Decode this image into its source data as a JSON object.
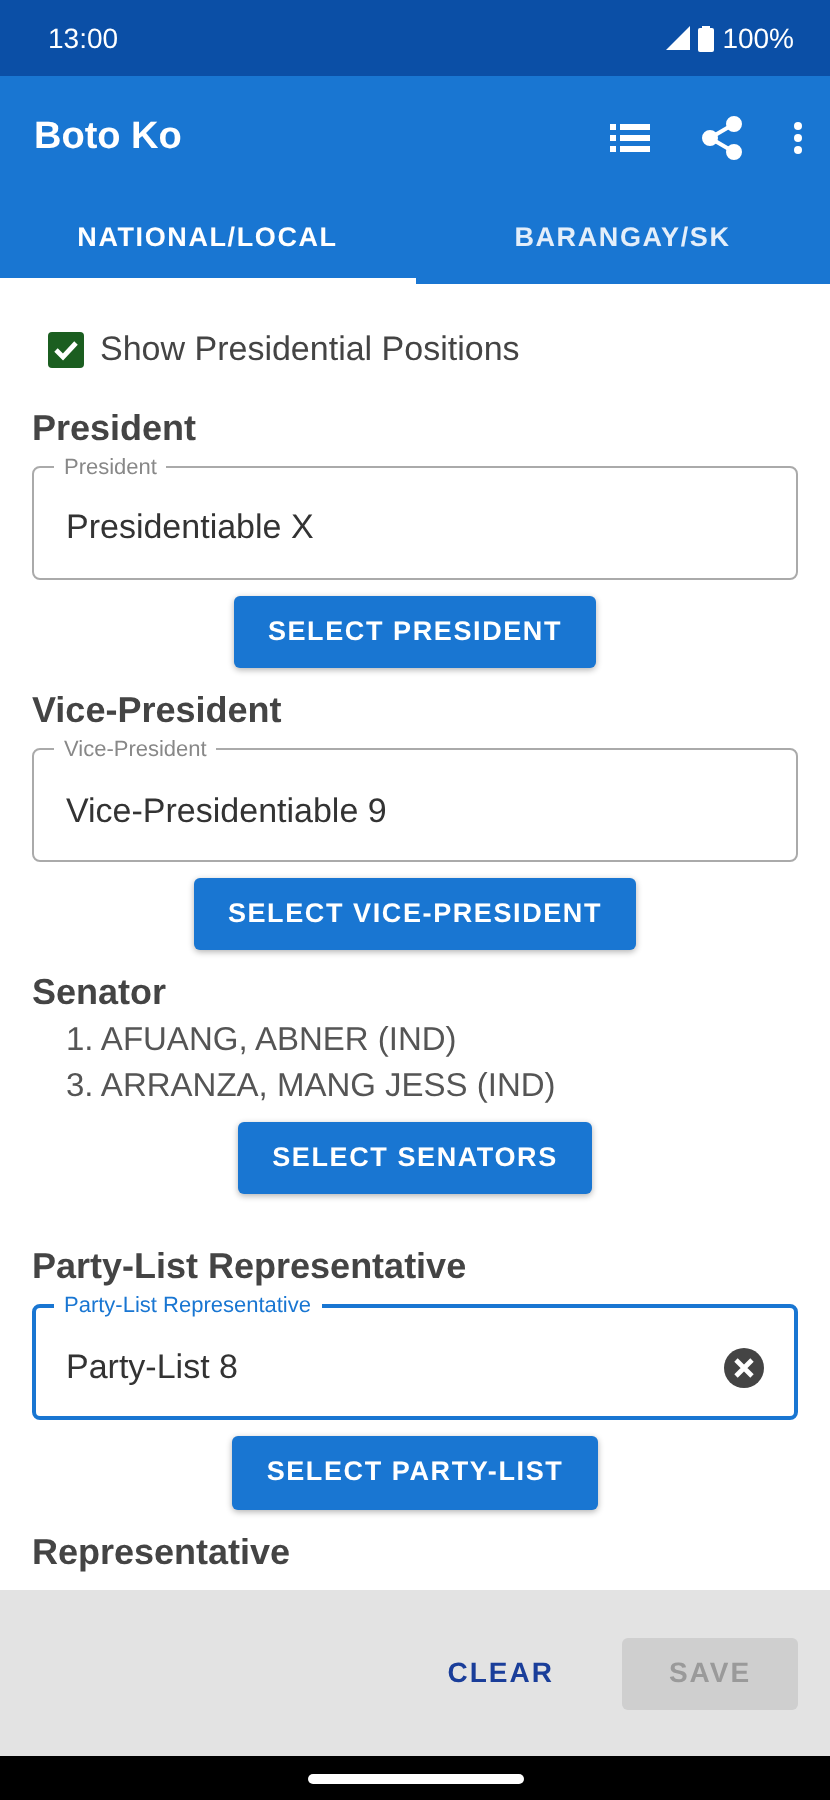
{
  "status_bar": {
    "time": "13:00",
    "battery": "100%"
  },
  "app_bar": {
    "title": "Boto Ko"
  },
  "tabs": [
    {
      "label": "NATIONAL/LOCAL",
      "selected": true
    },
    {
      "label": "BARANGAY/SK",
      "selected": false
    }
  ],
  "show_presidential": {
    "label": "Show Presidential Positions",
    "checked": true
  },
  "sections": [
    {
      "kind": "field",
      "heading": "President",
      "field_label": "President",
      "value": "Presidentiable X",
      "focused": false,
      "button": "SELECT PRESIDENT"
    },
    {
      "kind": "field",
      "heading": "Vice-President",
      "field_label": "Vice-President",
      "value": "Vice-Presidentiable 9",
      "focused": false,
      "button": "SELECT VICE-PRESIDENT"
    },
    {
      "kind": "list",
      "heading": "Senator",
      "items": [
        "1. AFUANG, ABNER (IND)",
        "3. ARRANZA, MANG JESS (IND)"
      ],
      "button": "SELECT SENATORS"
    },
    {
      "kind": "field",
      "heading": "Party-List Representative",
      "field_label": "Party-List Representative",
      "value": "Party-List 8",
      "focused": true,
      "button": "SELECT PARTY-LIST"
    },
    {
      "kind": "heading",
      "heading": "Representative"
    }
  ],
  "footer": {
    "clear": "CLEAR",
    "save": "SAVE",
    "save_disabled": true
  }
}
